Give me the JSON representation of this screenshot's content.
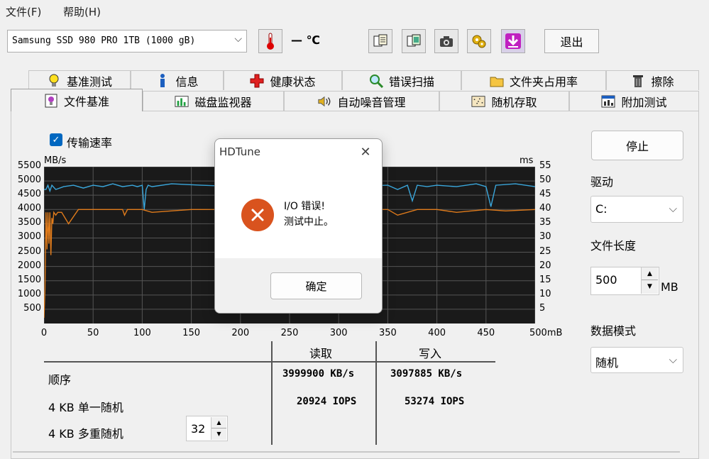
{
  "menu": {
    "file": "文件(F)",
    "help": "帮助(H)"
  },
  "toolbar": {
    "drive": "Samsung SSD 980 PRO 1TB (1000 gB)",
    "temperature": "— ℃",
    "exit_label": "退出",
    "icons": [
      "copy-text-icon",
      "copy-screen-icon",
      "camera-icon",
      "settings-gears-icon",
      "download-arrow-icon"
    ]
  },
  "tabs_row1": [
    "基准测试",
    "信息",
    "健康状态",
    "错误扫描",
    "文件夹占用率",
    "擦除"
  ],
  "tabs_row2": [
    "文件基准",
    "磁盘监视器",
    "自动噪音管理",
    "随机存取",
    "附加测试"
  ],
  "panel": {
    "transfer_rate_label": "传输速率",
    "stop_label": "停止",
    "drive_label": "驱动",
    "drive_value": "C:",
    "file_length_label": "文件长度",
    "file_length_value": "500",
    "file_length_unit": "MB",
    "data_mode_label": "数据模式",
    "data_mode_value": "随机"
  },
  "chart_data": {
    "type": "line",
    "ylabel_left": "MB/s",
    "ylabel_right": "ms",
    "xlabel": "",
    "x_ticks": [
      "0",
      "50",
      "100",
      "150",
      "200",
      "250",
      "300",
      "350",
      "400",
      "450",
      "500mB"
    ],
    "y_left_ticks": [
      "5500",
      "5000",
      "4500",
      "4000",
      "3500",
      "3000",
      "2500",
      "2000",
      "1500",
      "1000",
      "500"
    ],
    "y_right_ticks": [
      "55",
      "50",
      "45",
      "40",
      "35",
      "30",
      "25",
      "20",
      "15",
      "10",
      "5"
    ],
    "xlim": [
      0,
      500
    ],
    "ylim_left": [
      0,
      5500
    ],
    "colors": {
      "read": "#3aa7dc",
      "write": "#e07b1b",
      "background": "#1a1a1a",
      "grid": "#555555"
    },
    "series": [
      {
        "values_x": [
          0,
          2,
          4,
          6,
          8,
          12,
          20,
          30,
          40,
          50,
          60,
          70,
          80,
          90,
          95,
          100,
          102,
          104,
          106,
          110,
          130,
          160,
          200,
          250,
          300,
          350,
          360,
          370,
          375,
          380,
          390,
          400,
          420,
          440,
          450,
          455,
          460,
          480,
          500
        ],
        "values_y": [
          4700,
          4700,
          4850,
          4650,
          4850,
          4700,
          4800,
          4850,
          4750,
          4850,
          4800,
          4900,
          4800,
          4850,
          4800,
          4850,
          4000,
          4700,
          4850,
          4800,
          4900,
          4850,
          4800,
          4850,
          4800,
          4850,
          4700,
          4850,
          4300,
          4850,
          4800,
          4850,
          4800,
          4900,
          4800,
          4100,
          4850,
          4900,
          4800
        ]
      },
      {
        "values_x": [
          0,
          1,
          2,
          3,
          4,
          5,
          6,
          7,
          8,
          9,
          10,
          12,
          14,
          18,
          25,
          35,
          50,
          80,
          82,
          85,
          100,
          110,
          150,
          200,
          250,
          300,
          350,
          360,
          380,
          400,
          420,
          450,
          470,
          500
        ],
        "values_y": [
          200,
          1200,
          3900,
          2600,
          3900,
          2800,
          3900,
          2400,
          3700,
          3500,
          3900,
          3800,
          3900,
          3900,
          3500,
          4000,
          4000,
          4000,
          3800,
          4000,
          4000,
          3900,
          4000,
          4000,
          4000,
          4000,
          4000,
          3800,
          4000,
          4000,
          3900,
          4000,
          3950,
          4000
        ]
      }
    ]
  },
  "results": {
    "col_read": "读取",
    "col_write": "写入",
    "row_seq": "顺序",
    "row_4k_single": "4 KB 单一随机",
    "row_4k_multi": "4 KB 多重随机",
    "queue_depth": "32",
    "seq_read": "3999900 KB/s",
    "seq_write": "3097885 KB/s",
    "rand_single_read": "20924 IOPS",
    "rand_single_write": "53274 IOPS"
  },
  "dialog": {
    "title": "HDTune",
    "line1": "I/O 错误!",
    "line2": "测试中止。",
    "ok_label": "确定"
  }
}
